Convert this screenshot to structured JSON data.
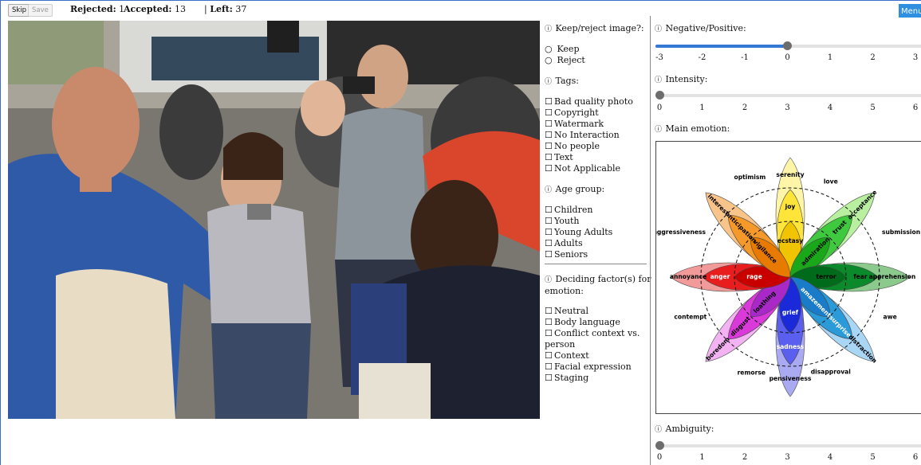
{
  "toolbar": {
    "skip_label": "Skip",
    "save_label": "Save",
    "rejected_label": "Rejected:",
    "rejected_value": "1",
    "accepted_label": "Accepted:",
    "accepted_value": "13",
    "left_prefix": "|",
    "left_label": "Left:",
    "left_value": "37",
    "menu_label": "Menu"
  },
  "keep_reject": {
    "question": "Keep/reject image?:",
    "options": [
      {
        "label": "Keep",
        "selected": false
      },
      {
        "label": "Reject",
        "selected": false
      }
    ]
  },
  "tags": {
    "question": "Tags:",
    "items": [
      "Bad quality photo",
      "Copyright",
      "Watermark",
      "No Interaction",
      "No people",
      "Text",
      "Not Applicable"
    ]
  },
  "age_group": {
    "question": "Age group:",
    "items": [
      "Children",
      "Youth",
      "Young Adults",
      "Adults",
      "Seniors"
    ]
  },
  "deciding": {
    "question_line1": "Deciding factor(s) for",
    "question_line2": "emotion:",
    "items": [
      "Neutral",
      "Body language",
      "Conflict context vs.",
      "person",
      "Context",
      "Facial expression",
      "Staging"
    ]
  },
  "negpos": {
    "question": "Negative/Positive:",
    "value": 0,
    "min": -3,
    "max": 3,
    "ticks": [
      "-3",
      "-2",
      "-1",
      "0",
      "1",
      "2",
      "3"
    ]
  },
  "intensity": {
    "question": "Intensity:",
    "value": 0,
    "min": 0,
    "max": 6,
    "ticks": [
      "0",
      "1",
      "2",
      "3",
      "4",
      "5",
      "6"
    ]
  },
  "main_emotion": {
    "question": "Main emotion:",
    "outer_labels": {
      "optimism": "optimism",
      "love": "love",
      "submission": "submission",
      "awe": "awe",
      "disapproval": "disapproval",
      "remorse": "remorse",
      "contempt": "contempt",
      "aggressiveness": "aggressiveness"
    },
    "petals": {
      "serenity": "serenity",
      "joy": "joy",
      "ecstasy": "ecstasy",
      "acceptance": "acceptance",
      "trust": "trust",
      "admiration": "admiration",
      "apprehension": "apprehension",
      "fear": "fear",
      "terror": "terror",
      "distraction": "distraction",
      "surprise": "surprise",
      "amazement": "amazement",
      "pensiveness": "pensiveness",
      "sadness": "sadness",
      "grief": "grief",
      "boredom": "boredom",
      "disgust": "disgust",
      "loathing": "loathing",
      "annoyance": "annoyance",
      "anger": "anger",
      "rage": "rage",
      "interest": "interest",
      "anticipation": "anticipation",
      "vigilance": "vigilance"
    },
    "colors": {
      "joy": "#ffe43a",
      "trust": "#3ec93e",
      "fear": "#0a8a2a",
      "surprise": "#2a9ad8",
      "sadness": "#5a5ff0",
      "disgust": "#d93ad9",
      "anger": "#e81e1e",
      "anticipation": "#f59a2a"
    }
  },
  "ambiguity": {
    "question": "Ambiguity:",
    "value": 0,
    "min": 0,
    "max": 6,
    "ticks": [
      "0",
      "1",
      "2",
      "3",
      "4",
      "5",
      "6"
    ]
  }
}
